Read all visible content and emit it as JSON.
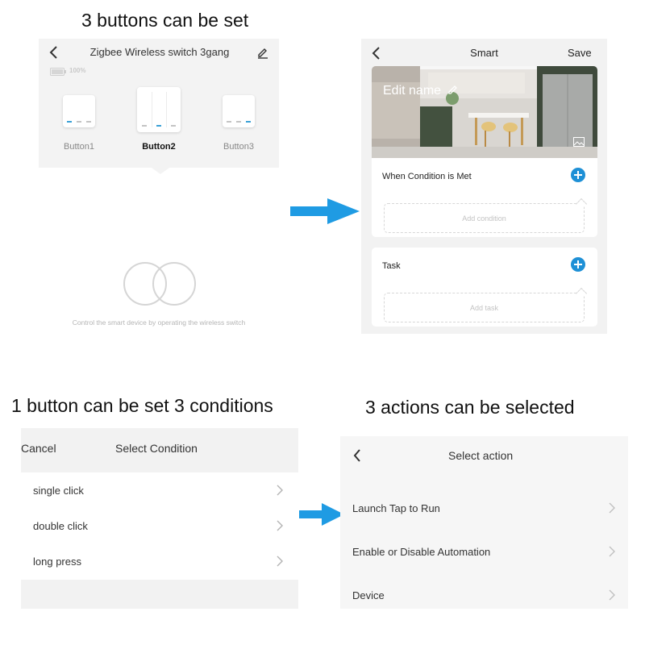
{
  "captions": {
    "buttons": "3 buttons can be set",
    "conditions": "1 button can be set 3 conditions",
    "actions": "3 actions can be selected"
  },
  "switch_screen": {
    "title": "Zigbee Wireless switch 3gang",
    "battery": "100%",
    "buttons": [
      {
        "label": "Button1",
        "selected": false
      },
      {
        "label": "Button2",
        "selected": true
      },
      {
        "label": "Button3",
        "selected": false
      }
    ],
    "description": "Control the smart device by operating the wireless switch",
    "icons": {
      "back": "chevron-left-icon",
      "edit": "pencil-icon",
      "battery": "battery-icon",
      "graphic": "two-rings-icon"
    }
  },
  "smart_screen": {
    "title": "Smart",
    "save_label": "Save",
    "scene_name": "Edit name",
    "condition_title": "When Condition is Met",
    "add_condition": "Add condition",
    "task_title": "Task",
    "add_task": "Add task",
    "icons": {
      "back": "chevron-left-icon",
      "edit": "pencil-icon",
      "image": "image-icon",
      "add": "plus-circle-icon"
    },
    "colors": {
      "accent": "#1e90d6"
    }
  },
  "condition_screen": {
    "cancel_label": "Cancel",
    "title": "Select Condition",
    "options": [
      "single click",
      "double click",
      "long press"
    ]
  },
  "action_screen": {
    "title": "Select action",
    "options": [
      "Launch Tap to Run",
      "Enable or Disable Automation",
      "Device"
    ]
  },
  "colors": {
    "arrow": "#1f9be3"
  }
}
